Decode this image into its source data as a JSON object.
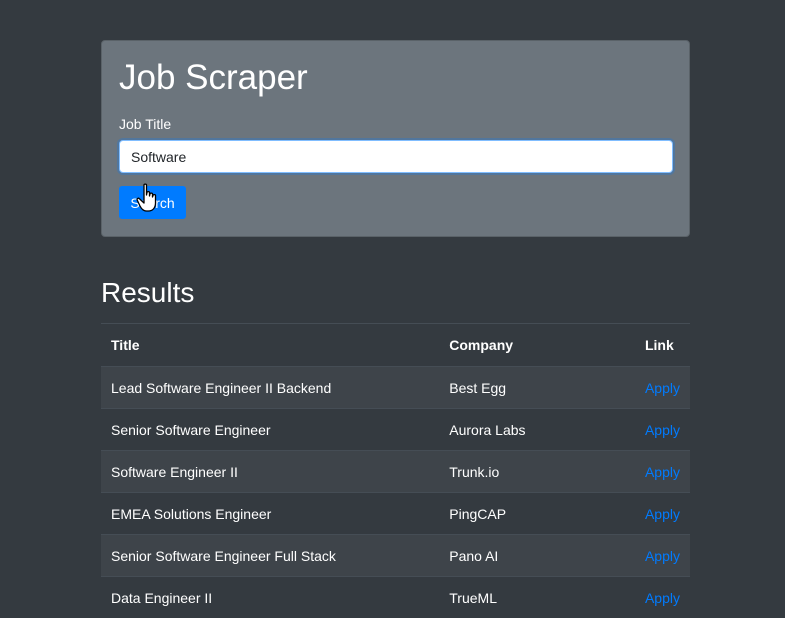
{
  "app": {
    "title": "Job Scraper"
  },
  "search": {
    "label": "Job Title",
    "value": "Software",
    "button_label": "Search"
  },
  "results": {
    "heading": "Results",
    "columns": [
      "Title",
      "Company",
      "Link"
    ],
    "rows": [
      {
        "title": "Lead Software Engineer II Backend",
        "company": "Best Egg",
        "link": "Apply"
      },
      {
        "title": "Senior Software Engineer",
        "company": "Aurora Labs",
        "link": "Apply"
      },
      {
        "title": "Software Engineer II",
        "company": "Trunk.io",
        "link": "Apply"
      },
      {
        "title": "EMEA Solutions Engineer",
        "company": "PingCAP",
        "link": "Apply"
      },
      {
        "title": "Senior Software Engineer Full Stack",
        "company": "Pano AI",
        "link": "Apply"
      },
      {
        "title": "Data Engineer II",
        "company": "TrueML",
        "link": "Apply"
      }
    ]
  },
  "colors": {
    "background": "#343a40",
    "card": "#6c757d",
    "primary": "#007bff",
    "striped_row": "#3e444a"
  },
  "icons": {
    "cursor": "hand-pointer-icon"
  }
}
